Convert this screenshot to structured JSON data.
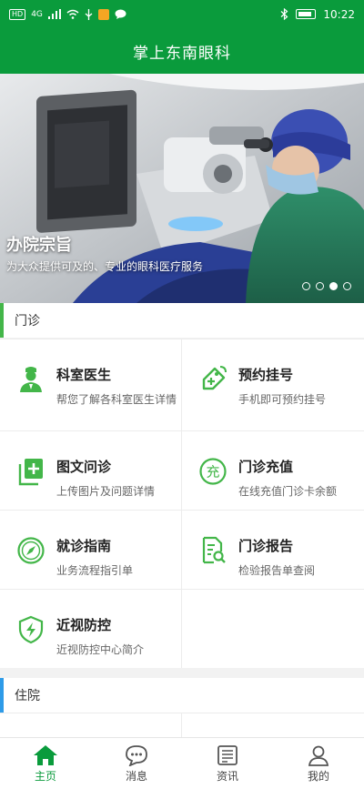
{
  "status_bar": {
    "network_label": "HD",
    "signal_label": "4G",
    "time": "10:22"
  },
  "header": {
    "title": "掌上东南眼科"
  },
  "banner": {
    "title": "办院宗旨",
    "subtitle": "为大众提供可及的、专业的眼科医疗服务",
    "dots_count": 4,
    "active_dot_index": 2
  },
  "sections": {
    "outpatient": {
      "label": "门诊",
      "accent": "#43b649"
    },
    "inpatient": {
      "label": "住院",
      "accent": "#2e9be8"
    }
  },
  "outpatient_items": [
    {
      "title": "科室医生",
      "desc": "帮您了解各科室医生详情",
      "icon": "doctor-icon"
    },
    {
      "title": "预约挂号",
      "desc": "手机即可预约挂号",
      "icon": "tag-icon"
    },
    {
      "title": "图文问诊",
      "desc": "上传图片及问题详情",
      "icon": "add-document-icon"
    },
    {
      "title": "门诊充值",
      "desc": "在线充值门诊卡余额",
      "icon": "recharge-icon"
    },
    {
      "title": "就诊指南",
      "desc": "业务流程指引单",
      "icon": "compass-icon"
    },
    {
      "title": "门诊报告",
      "desc": "检验报告单查阅",
      "icon": "report-search-icon"
    },
    {
      "title": "近视防控",
      "desc": "近视防控中心简介",
      "icon": "shield-bolt-icon"
    }
  ],
  "bottom_nav": [
    {
      "label": "主页",
      "icon": "home-icon",
      "active": true
    },
    {
      "label": "消息",
      "icon": "chat-icon",
      "active": false
    },
    {
      "label": "资讯",
      "icon": "news-icon",
      "active": false
    },
    {
      "label": "我的",
      "icon": "user-icon",
      "active": false
    }
  ],
  "colors": {
    "brand": "#0a9b3c",
    "icon_green": "#43b649"
  }
}
